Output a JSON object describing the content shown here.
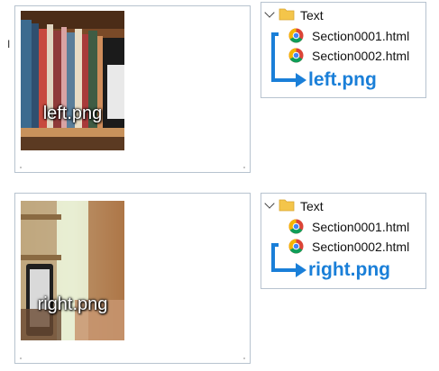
{
  "top_fragment": "I",
  "panel_left": {
    "image_label": "left.png",
    "tree": {
      "folder_label": "Text",
      "files": [
        "Section0001.html",
        "Section0002.html"
      ],
      "target_label": "left.png"
    }
  },
  "panel_right": {
    "image_label": "right.png",
    "tree": {
      "folder_label": "Text",
      "files": [
        "Section0001.html",
        "Section0002.html"
      ],
      "target_label": "right.png"
    }
  },
  "colors": {
    "accent_blue": "#1a7fd8",
    "folder_yellow": "#f4c54a",
    "border": "#b7c3cf"
  },
  "icons": {
    "folder": "folder-icon",
    "file": "chrome-icon",
    "expand": "chevron-down-icon",
    "arrow": "arrow-right-icon"
  }
}
